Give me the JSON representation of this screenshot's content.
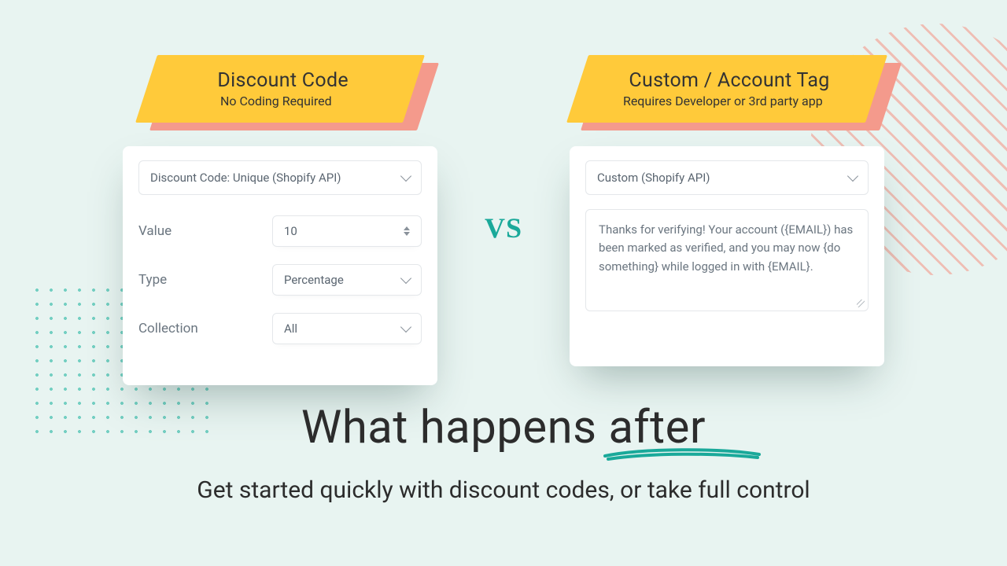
{
  "left": {
    "banner_title": "Discount Code",
    "banner_sub": "No Coding Required",
    "select_label": "Discount Code: Unique (Shopify API)",
    "rows": {
      "value_label": "Value",
      "value_input": "10",
      "type_label": "Type",
      "type_value": "Percentage",
      "collection_label": "Collection",
      "collection_value": "All"
    }
  },
  "vs_label": "VS",
  "right": {
    "banner_title": "Custom / Account Tag",
    "banner_sub": "Requires Developer or 3rd party app",
    "select_label": "Custom (Shopify API)",
    "textarea_value": "Thanks for verifying! Your account ({EMAIL}) has been marked as verified, and you may now {do something} while logged in with {EMAIL}."
  },
  "headline": "What happens ",
  "headline_emph": "after",
  "subhead": "Get started quickly with discount codes, or take full control"
}
